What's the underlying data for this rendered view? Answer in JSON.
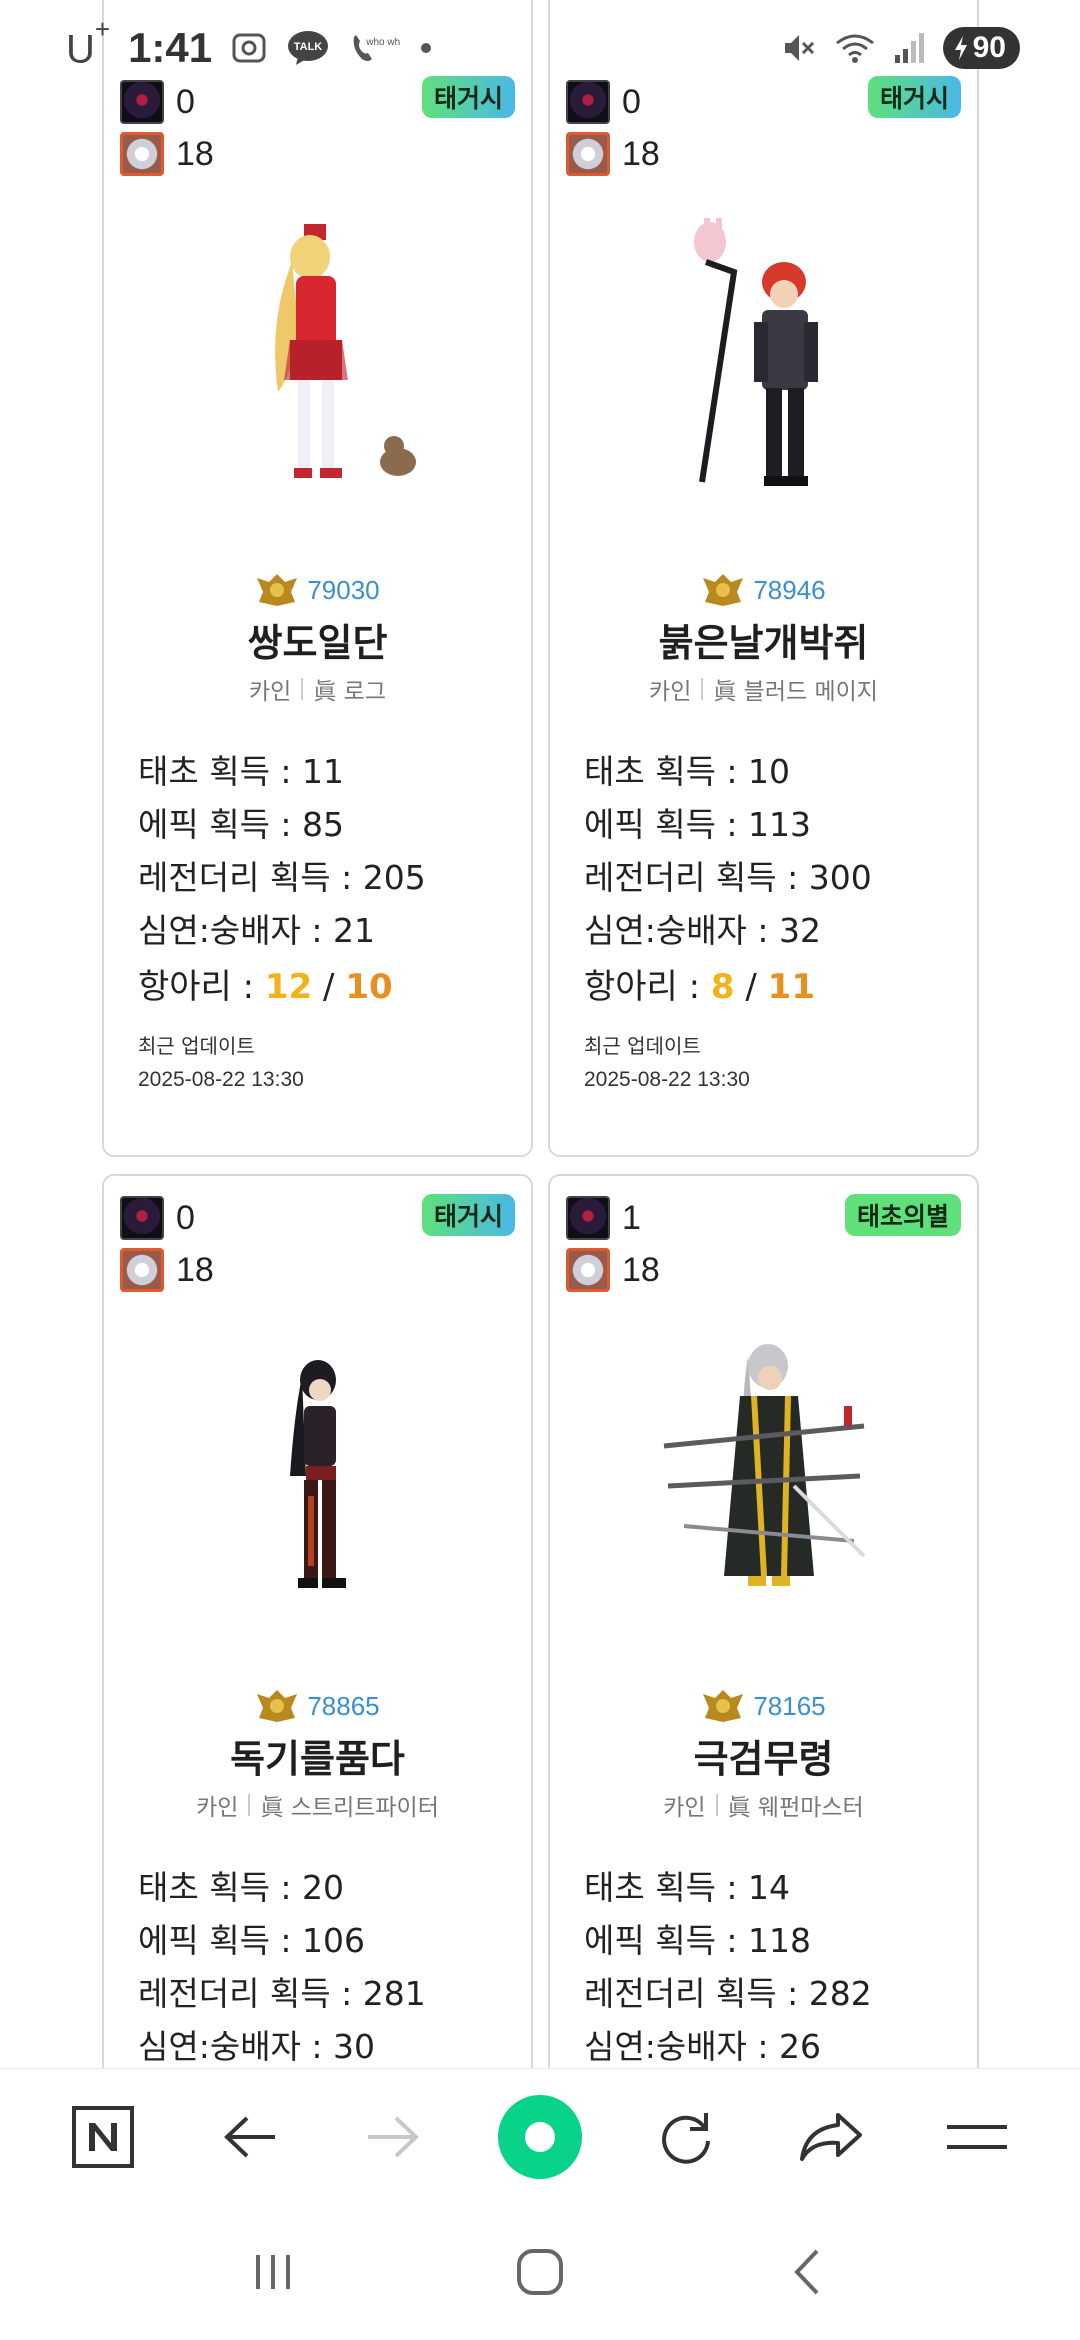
{
  "status_bar": {
    "carrier": "U",
    "carrier_sup": "+",
    "time": "1:41",
    "battery": "90",
    "talk_label": "TALK",
    "whowho_label": "who who"
  },
  "cards": [
    {
      "dark_count": "0",
      "light_count": "18",
      "badge": "태거시",
      "fame": "79030",
      "name": "쌍도일단",
      "server": "카인",
      "job": "眞 로그",
      "stats": [
        "태초 획득 : 11",
        "에픽 획득 : 85",
        "레전더리 획득 : 205",
        "심연:숭배자 : 21"
      ],
      "hang_label": "항아리 : ",
      "hang_a": "12",
      "hang_slash": " / ",
      "hang_b": "10",
      "update_label": "최근 업데이트",
      "update_time": "2025-08-22 13:30"
    },
    {
      "dark_count": "0",
      "light_count": "18",
      "badge": "태거시",
      "fame": "78946",
      "name": "붉은날개박쥐",
      "server": "카인",
      "job": "眞 블러드 메이지",
      "stats": [
        "태초 획득 : 10",
        "에픽 획득 : 113",
        "레전더리 획득 : 300",
        "심연:숭배자 : 32"
      ],
      "hang_label": "항아리 : ",
      "hang_a": "8",
      "hang_slash": " / ",
      "hang_b": "11",
      "update_label": "최근 업데이트",
      "update_time": "2025-08-22 13:30"
    },
    {
      "dark_count": "0",
      "light_count": "18",
      "badge": "태거시",
      "fame": "78865",
      "name": "독기를품다",
      "server": "카인",
      "job": "眞 스트리트파이터",
      "stats": [
        "태초 획득 : 20",
        "에픽 획득 : 106",
        "레전더리 획득 : 281",
        "심연:숭배자 : 30"
      ]
    },
    {
      "dark_count": "1",
      "light_count": "18",
      "badge": "태초의별",
      "fame": "78165",
      "name": "극검무령",
      "server": "카인",
      "job": "眞 웨펀마스터",
      "stats": [
        "태초 획득 : 14",
        "에픽 획득 : 118",
        "레전더리 획득 : 282",
        "심연:숭배자 : 26"
      ]
    }
  ],
  "colors": {
    "fame_blue": "#3b8fd1",
    "hang_yellow": "#f2b21b",
    "hang_orange": "#e8901f",
    "badge_green": "#5fe07a",
    "naver_green": "#03c75a"
  },
  "toolbar": {
    "icons": [
      "naver-n-icon",
      "back-arrow-icon",
      "forward-arrow-icon",
      "green-dot-home-icon",
      "refresh-icon",
      "share-icon",
      "menu-icon"
    ]
  },
  "navbar": {
    "icons": [
      "recent-apps-icon",
      "home-icon",
      "back-icon"
    ]
  }
}
